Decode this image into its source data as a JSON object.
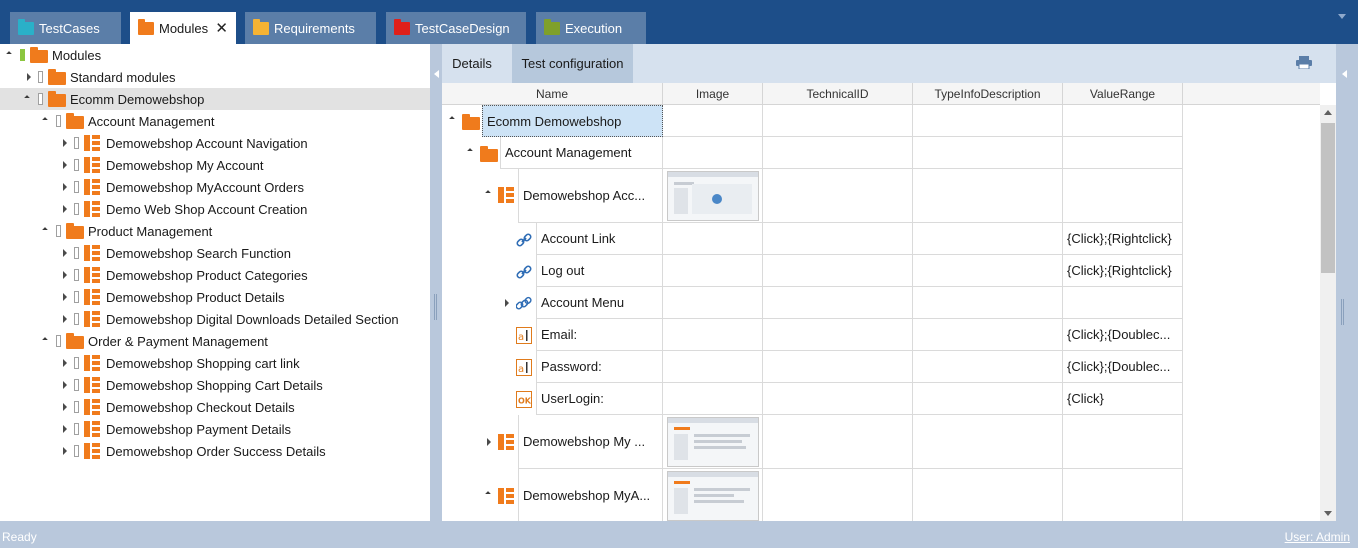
{
  "tabs": [
    {
      "label": "TestCases",
      "color": "#2ab0c8"
    },
    {
      "label": "Modules",
      "color": "#f07b1c",
      "active": true
    },
    {
      "label": "Requirements",
      "color": "#f6b333"
    },
    {
      "label": "TestCaseDesign",
      "color": "#e0201a"
    },
    {
      "label": "Execution",
      "color": "#7fa02a"
    }
  ],
  "tree": {
    "root": "Modules",
    "items": [
      {
        "label": "Standard modules",
        "type": "folder"
      },
      {
        "label": "Ecomm Demowebshop",
        "type": "folder"
      },
      {
        "label": "Account Management",
        "type": "folder"
      },
      {
        "label": "Demowebshop Account Navigation",
        "type": "module"
      },
      {
        "label": "Demowebshop My Account",
        "type": "module"
      },
      {
        "label": "Demowebshop MyAccount Orders",
        "type": "module"
      },
      {
        "label": "Demo Web Shop Account Creation",
        "type": "module"
      },
      {
        "label": "Product Management",
        "type": "folder"
      },
      {
        "label": "Demowebshop Search Function",
        "type": "module"
      },
      {
        "label": "Demowebshop Product Categories",
        "type": "module"
      },
      {
        "label": "Demowebshop Product Details",
        "type": "module"
      },
      {
        "label": "Demowebshop Digital Downloads Detailed Section",
        "type": "module"
      },
      {
        "label": "Order & Payment Management",
        "type": "folder"
      },
      {
        "label": "Demowebshop Shopping cart link",
        "type": "module"
      },
      {
        "label": "Demowebshop Shopping Cart Details",
        "type": "module"
      },
      {
        "label": "Demowebshop Checkout Details",
        "type": "module"
      },
      {
        "label": "Demowebshop Payment Details",
        "type": "module"
      },
      {
        "label": "Demowebshop Order Success Details",
        "type": "module"
      }
    ]
  },
  "details": {
    "subtabs": [
      "Details",
      "Test configuration"
    ],
    "columns": [
      "Name",
      "Image",
      "TechnicalID",
      "TypeInfoDescription",
      "ValueRange"
    ],
    "rows": [
      {
        "name": "Ecomm Demowebshop",
        "value_range": ""
      },
      {
        "name": "Account Management",
        "value_range": ""
      },
      {
        "name": "Demowebshop Acc...",
        "value_range": ""
      },
      {
        "name": "Account Link",
        "value_range": "{Click};{Rightclick}"
      },
      {
        "name": "Log out",
        "value_range": "{Click};{Rightclick}"
      },
      {
        "name": "Account Menu",
        "value_range": ""
      },
      {
        "name": "Email:",
        "value_range": "{Click};{Doublec..."
      },
      {
        "name": "Password:",
        "value_range": "{Click};{Doublec..."
      },
      {
        "name": "UserLogin:",
        "value_range": "{Click}"
      },
      {
        "name": "Demowebshop My ...",
        "value_range": ""
      },
      {
        "name": "Demowebshop MyA...",
        "value_range": ""
      }
    ]
  },
  "status": {
    "text": "Ready",
    "user": "User: Admin"
  }
}
